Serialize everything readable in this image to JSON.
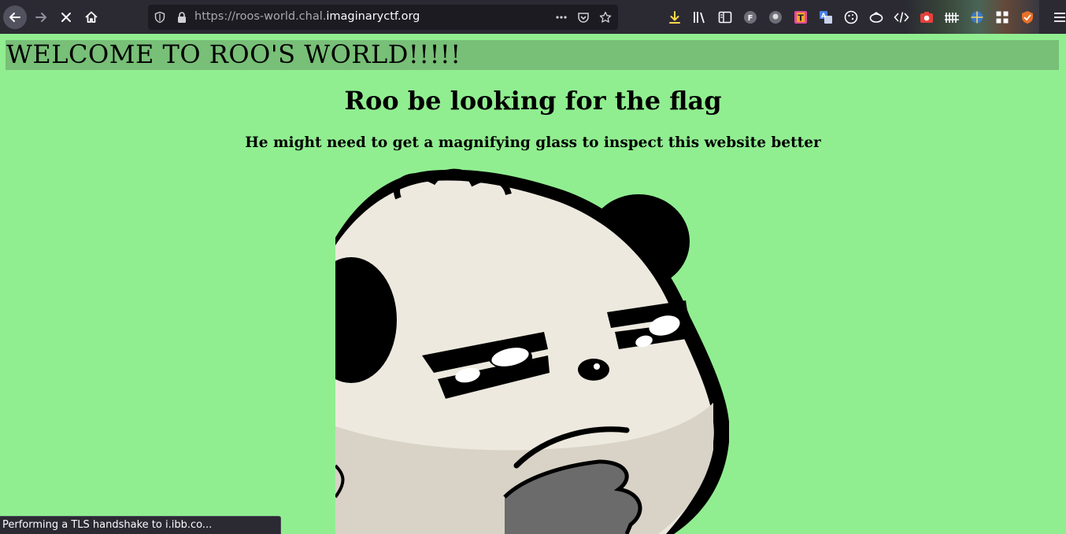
{
  "browser": {
    "url_prefix": "https://roos-world.chal.",
    "url_domain": "imaginaryctf.org",
    "theme_color": "#2b2a33",
    "toolbar_icons": [
      "download-icon",
      "library-icon",
      "reader-sidebar-icon",
      "extension-f-icon",
      "extension-ghost-icon",
      "extension-t-icon",
      "translate-icon",
      "cookie-icon",
      "extension-bird-icon",
      "code-icon",
      "screenshot-icon",
      "extension-fence-icon",
      "extension-globe-icon",
      "extension-grid-icon",
      "extension-shield-icon",
      "menu-icon"
    ]
  },
  "page": {
    "background": "#90ee90",
    "welcome": "WELCOME TO ROO'S WORLD!!!!!",
    "heading": "Roo be looking for the flag",
    "subheading": "He might need to get a magnifying glass to inspect this website better",
    "image_subject": "roo-panda-thinking"
  },
  "status": {
    "text": "Performing a TLS handshake to i.ibb.co..."
  }
}
